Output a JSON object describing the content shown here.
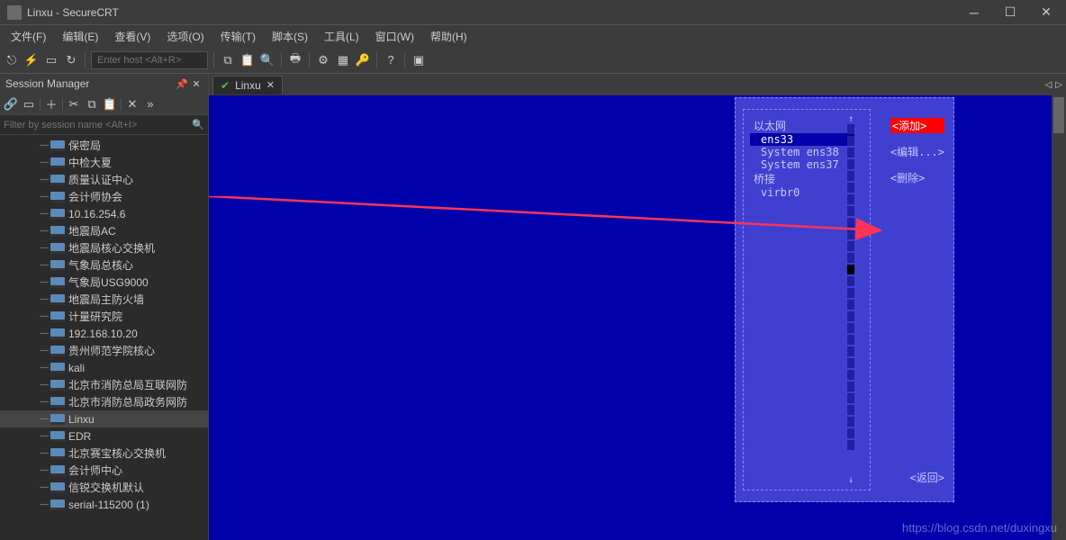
{
  "title": "Linxu - SecureCRT",
  "menus": [
    "文件(F)",
    "编辑(E)",
    "查看(V)",
    "选项(O)",
    "传输(T)",
    "脚本(S)",
    "工具(L)",
    "窗口(W)",
    "帮助(H)"
  ],
  "host_placeholder": "Enter host <Alt+R>",
  "sidebar": {
    "title": "Session Manager",
    "filter_placeholder": "Filter by session name <Alt+I>",
    "items": [
      "保密局",
      "中检大夏",
      "质量认证中心",
      "会计师协会",
      "10.16.254.6",
      "地震局AC",
      "地震局核心交换机",
      "气象局总核心",
      "气象局USG9000",
      "地震局主防火墙",
      "计量研究院",
      "192.168.10.20",
      "贵州师范学院核心",
      "kali",
      "北京市消防总局互联网防",
      "北京市消防总局政务网防",
      "Linxu",
      "EDR",
      "北京赛宝核心交换机",
      "会计师中心",
      "信锐交换机默认",
      "serial-115200 (1)"
    ],
    "selected_index": 16
  },
  "tab": {
    "label": "Linxu"
  },
  "dialog": {
    "sections": [
      {
        "header": "以太网",
        "items": [
          "ens33",
          "System ens38",
          "System ens37"
        ],
        "selected": 0
      },
      {
        "header": "桥接",
        "items": [
          "virbr0"
        ]
      }
    ],
    "buttons": {
      "add": "<添加>",
      "edit": "<编辑...>",
      "delete": "<删除>",
      "back": "<返回>"
    }
  },
  "watermark": "https://blog.csdn.net/duxingxu"
}
